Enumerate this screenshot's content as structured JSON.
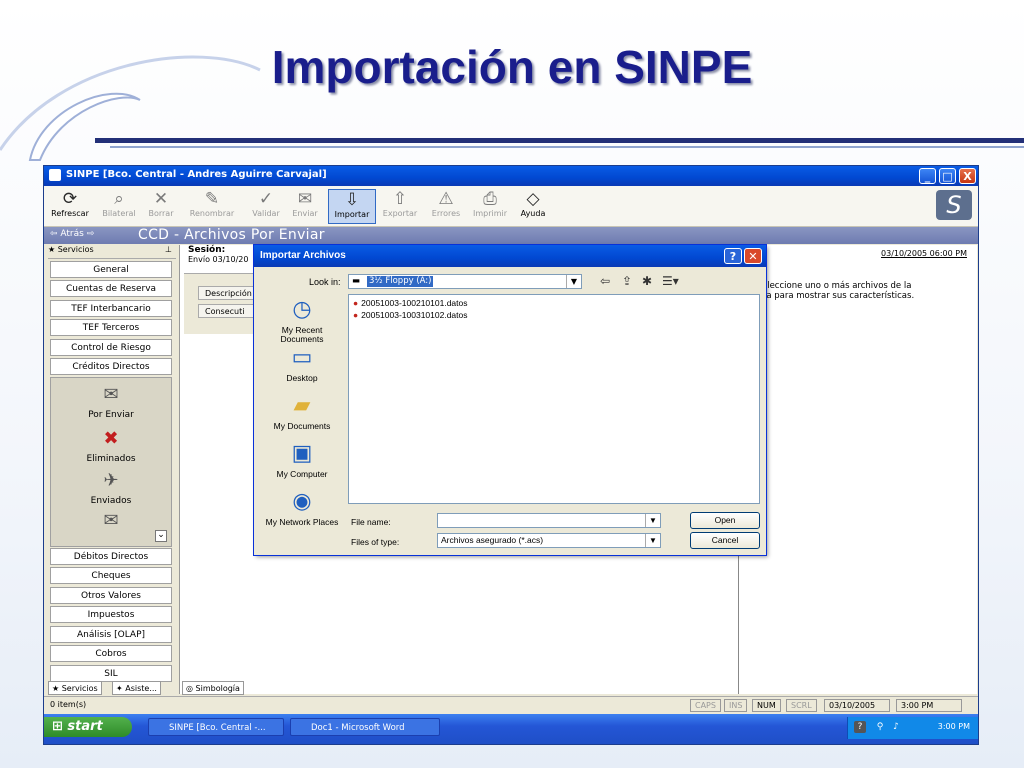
{
  "slide": {
    "title": "Importación en SINPE"
  },
  "window": {
    "title": "SINPE [Bco. Central - Andres Aguirre Carvajal]",
    "controls": [
      "_",
      "□",
      "X"
    ]
  },
  "toolbar": {
    "items": [
      {
        "label": "Refrescar",
        "icon": "refresh-icon",
        "enabled": true
      },
      {
        "label": "Bilateral",
        "icon": "search-icon",
        "enabled": false
      },
      {
        "label": "Borrar",
        "icon": "delete-icon",
        "enabled": false
      },
      {
        "label": "Renombrar",
        "icon": "rename-icon",
        "enabled": false
      },
      {
        "label": "Validar",
        "icon": "validate-icon",
        "enabled": false
      },
      {
        "label": "Enviar",
        "icon": "send-icon",
        "enabled": false
      },
      {
        "label": "Importar",
        "icon": "import-icon",
        "enabled": true,
        "selected": true
      },
      {
        "label": "Exportar",
        "icon": "export-icon",
        "enabled": false
      },
      {
        "label": "Errores",
        "icon": "errors-icon",
        "enabled": false
      },
      {
        "label": "Imprimir",
        "icon": "print-icon",
        "enabled": false
      },
      {
        "label": "Ayuda",
        "icon": "help-icon",
        "enabled": true
      }
    ]
  },
  "nav": {
    "back": "Atrás",
    "path": "CCD - Archivos Por Enviar"
  },
  "leftpane": {
    "header": "Servicios",
    "buttons_top": [
      "General",
      "Cuentas de Reserva",
      "TEF Interbancario",
      "TEF Terceros",
      "Control de Riesgo",
      "Créditos Directos"
    ],
    "subitems": [
      "Por Enviar",
      "Eliminados",
      "Enviados"
    ],
    "buttons_bottom": [
      "Débitos Directos",
      "Cheques",
      "Otros Valores",
      "Impuestos",
      "Análisis [OLAP]",
      "Cobros",
      "SIL"
    ],
    "tabs": [
      "Servicios",
      "Asiste..."
    ]
  },
  "main": {
    "sesion_label": "Sesión:",
    "envio": "Envío 03/10/20",
    "grid_headers": [
      "Descripción",
      "Consecuti"
    ],
    "date": "03/10/2005 06:00 PM",
    "info": "Seleccione uno o más archivos de la lista para mostrar sus características.",
    "bottom_tab": "Simbología"
  },
  "status": {
    "items": "0 item(s)",
    "cells": [
      "CAPS",
      "INS",
      "NUM",
      "SCRL",
      "03/10/2005",
      "3:00 PM"
    ]
  },
  "taskbar": {
    "start": "start",
    "tasks": [
      "SINPE [Bco. Central -...",
      "Doc1 - Microsoft Word"
    ],
    "time": "3:00 PM"
  },
  "dialog": {
    "title": "Importar Archivos",
    "look_in_label": "Look in:",
    "look_in_value": "3½ Floppy (A:)",
    "places": [
      "My Recent Documents",
      "Desktop",
      "My Documents",
      "My Computer",
      "My Network Places"
    ],
    "files": [
      "20051003-100210101.datos",
      "20051003-100310102.datos"
    ],
    "file_name_label": "File name:",
    "file_name_value": "",
    "file_type_label": "Files of type:",
    "file_type_value": "Archivos asegurado (*.acs)",
    "open_label": "Open",
    "cancel_label": "Cancel"
  }
}
